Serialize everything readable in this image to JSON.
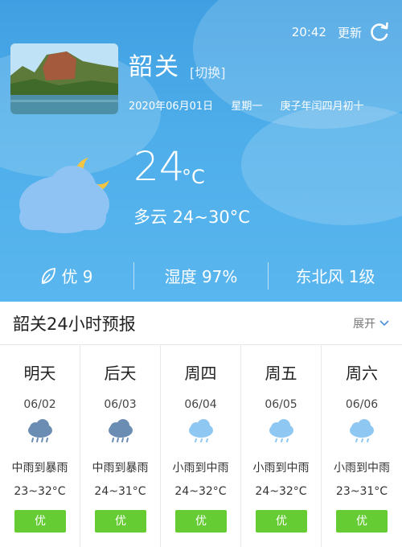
{
  "topbar": {
    "time": "20:42",
    "refresh_label": "更新"
  },
  "location": {
    "city": "韶关",
    "switch_label": "[切换]",
    "date": "2020年06月01日",
    "weekday": "星期一",
    "lunar": "庚子年闰四月初十"
  },
  "current": {
    "temp": "24",
    "unit": "°C",
    "condition": "多云 24~30°C"
  },
  "metrics": {
    "aqi": "优 9",
    "humidity": "湿度 97%",
    "wind": "东北风 1级"
  },
  "forecast_section": {
    "title": "韶关24小时预报",
    "expand_label": "展开"
  },
  "forecast": [
    {
      "name": "明天",
      "date": "06/02",
      "desc": "中雨到暴雨",
      "temp": "23~32°C",
      "aqi": "优",
      "icon": "heavy-rain-icon"
    },
    {
      "name": "后天",
      "date": "06/03",
      "desc": "中雨到暴雨",
      "temp": "24~31°C",
      "aqi": "优",
      "icon": "heavy-rain-icon"
    },
    {
      "name": "周四",
      "date": "06/04",
      "desc": "小雨到中雨",
      "temp": "24~32°C",
      "aqi": "优",
      "icon": "light-rain-icon"
    },
    {
      "name": "周五",
      "date": "06/05",
      "desc": "小雨到中雨",
      "temp": "24~32°C",
      "aqi": "优",
      "icon": "light-rain-icon"
    },
    {
      "name": "周六",
      "date": "06/06",
      "desc": "小雨到中雨",
      "temp": "23~31°C",
      "aqi": "优",
      "icon": "light-rain-icon"
    }
  ],
  "colors": {
    "sky": "#4eaeea",
    "aqi_good": "#66cc33",
    "heavy_rain_cloud": "#6c8db3",
    "light_rain_cloud": "#8ec7f2"
  }
}
